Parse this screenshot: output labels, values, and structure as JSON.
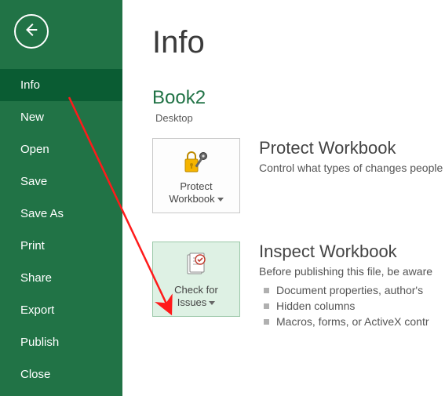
{
  "sidebar": {
    "items": [
      {
        "label": "Info",
        "selected": true
      },
      {
        "label": "New"
      },
      {
        "label": "Open"
      },
      {
        "label": "Save"
      },
      {
        "label": "Save As"
      },
      {
        "label": "Print"
      },
      {
        "label": "Share"
      },
      {
        "label": "Export"
      },
      {
        "label": "Publish"
      },
      {
        "label": "Close"
      }
    ]
  },
  "page": {
    "title": "Info",
    "file_name": "Book2",
    "file_path": "Desktop"
  },
  "protect": {
    "button_line1": "Protect",
    "button_line2": "Workbook",
    "heading": "Protect Workbook",
    "desc": "Control what types of changes people"
  },
  "inspect": {
    "button_line1": "Check for",
    "button_line2": "Issues",
    "heading": "Inspect Workbook",
    "desc": "Before publishing this file, be aware",
    "bullets": [
      "Document properties, author's",
      "Hidden columns",
      "Macros, forms, or ActiveX contr"
    ]
  }
}
